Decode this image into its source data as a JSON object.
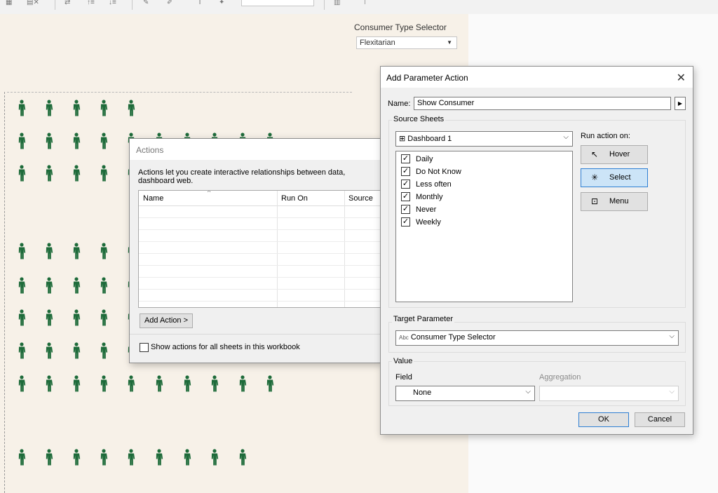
{
  "toolbar": {
    "icons": [
      "grid-icon",
      "clear-sheet-icon",
      "swap-icon",
      "sort-asc-icon",
      "sort-desc-icon",
      "highlight-icon",
      "pen-icon",
      "label-icon",
      "pin-icon",
      "view-icon",
      "presentation-icon"
    ]
  },
  "canvas": {
    "selector_title": "Consumer Type Selector",
    "selector_value": "Flexitarian",
    "person_color": "#1e6b3a",
    "background_color": "#f7f1e8"
  },
  "actions_dialog": {
    "title": "Actions",
    "description": "Actions let you create interactive relationships between data, dashboard web.",
    "columns": [
      "Name",
      "Run On",
      "Source"
    ],
    "add_action_label": "Add Action >",
    "show_all_label": "Show actions for all sheets in this workbook"
  },
  "param_dialog": {
    "title": "Add Parameter Action",
    "name_label": "Name:",
    "name_value": "Show Consumer",
    "source_sheets_label": "Source Sheets",
    "sheet_selector": "Dashboard 1",
    "sheets": [
      "Daily",
      "Do Not Know",
      "Less often",
      "Monthly",
      "Never",
      "Weekly"
    ],
    "run_action_label": "Run action on:",
    "run_options": [
      "Hover",
      "Select",
      "Menu"
    ],
    "selected_run_option": "Select",
    "target_parameter_label": "Target Parameter",
    "target_badge": "Abc",
    "target_value": "Consumer Type Selector",
    "value_label": "Value",
    "field_label": "Field",
    "field_value": "None",
    "aggregation_label": "Aggregation",
    "ok_label": "OK",
    "cancel_label": "Cancel",
    "accent_color": "#2f7fd3"
  }
}
